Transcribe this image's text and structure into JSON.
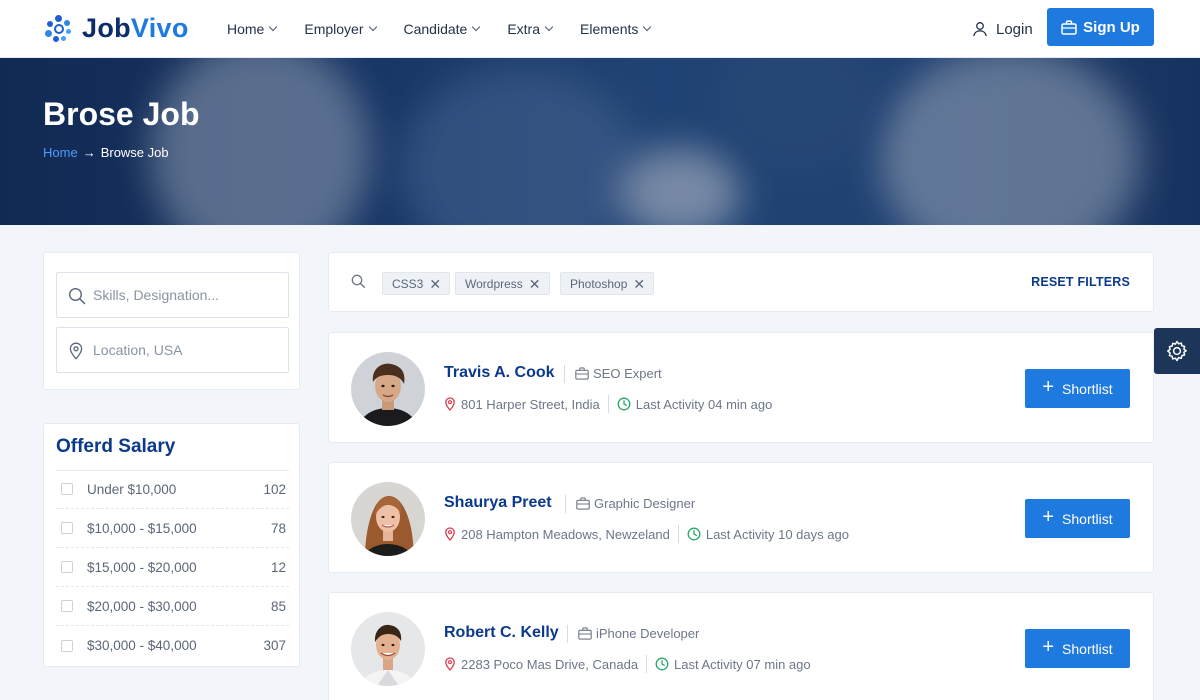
{
  "brand": {
    "name_part1": "Job",
    "name_part2": "Vivo"
  },
  "nav": [
    {
      "label": "Home"
    },
    {
      "label": "Employer"
    },
    {
      "label": "Candidate"
    },
    {
      "label": "Extra"
    },
    {
      "label": "Elements"
    }
  ],
  "auth": {
    "login_label": "Login",
    "signup_label": "Sign Up"
  },
  "banner": {
    "title": "Brose Job",
    "breadcrumb_home": "Home",
    "breadcrumb_current": "Browse Job"
  },
  "search": {
    "skills_placeholder": "Skills, Designation...",
    "location_placeholder": "Location, USA"
  },
  "salary": {
    "title": "Offerd Salary",
    "ranges": [
      {
        "label": "Under $10,000",
        "count": "102"
      },
      {
        "label": "$10,000 - $15,000",
        "count": "78"
      },
      {
        "label": "$15,000 - $20,000",
        "count": "12"
      },
      {
        "label": "$20,000 - $30,000",
        "count": "85"
      },
      {
        "label": "$30,000 - $40,000",
        "count": "307"
      }
    ]
  },
  "filters": {
    "tags": [
      "CSS3",
      "Wordpress",
      "Photoshop"
    ],
    "reset_label": "RESET FILTERS"
  },
  "candidates": [
    {
      "name": "Travis A. Cook",
      "role": "SEO Expert",
      "location": "801 Harper Street, India",
      "activity": "Last Activity 04 min ago",
      "action": "Shortlist"
    },
    {
      "name": "Shaurya Preet",
      "role": "Graphic Designer",
      "location": "208 Hampton Meadows, Newzeland",
      "activity": "Last Activity 10 days ago",
      "action": "Shortlist"
    },
    {
      "name": "Robert C. Kelly",
      "role": "iPhone Developer",
      "location": "2283 Poco Mas Drive, Canada",
      "activity": "Last Activity 07 min ago",
      "action": "Shortlist"
    }
  ],
  "colors": {
    "primary": "#1f7ae0",
    "navy": "#0b3a8c",
    "location_pin": "#e03a4e",
    "activity_clock": "#27a86a"
  }
}
